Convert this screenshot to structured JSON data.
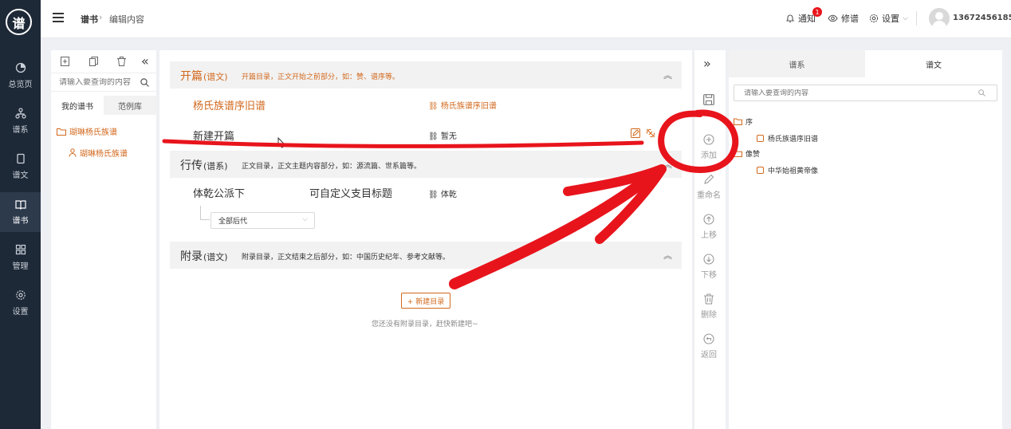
{
  "nav": {
    "logo": "谱",
    "items": [
      "总览页",
      "谱系",
      "谱文",
      "谱书",
      "管理",
      "设置"
    ]
  },
  "topbar": {
    "crumb_1": "谱书",
    "crumb_2": "编辑内容",
    "notify_label": "通知",
    "notify_badge": "1",
    "preview_label": "修谱",
    "settings_label": "设置",
    "phone": "13672456185"
  },
  "left": {
    "search_placeholder": "请输入要查询的内容",
    "tab_mine": "我的谱书",
    "tab_examples": "范例库",
    "tree_root": "瑚琳杨氏族谱",
    "tree_child": "瑚琳杨氏族谱"
  },
  "middle": {
    "s1_title": "开篇",
    "s1_tag": "(谱文)",
    "s1_desc": "开篇目录，正文开始之前部分，如：赞、谱序等。",
    "s1_row1_name": "杨氏族谱序旧谱",
    "s1_row1_link": "杨氏族谱序旧谱",
    "s1_row2_name": "新建开篇",
    "s1_row2_link": "暂无",
    "s2_title": "行传",
    "s2_tag": "(谱系)",
    "s2_desc": "正文目录，正文主题内容部分，如：源流篇、世系篇等。",
    "s2_row1_name": "体乾公派下",
    "s2_row1_custom": "可自定义支目标题",
    "s2_row1_link": "体乾",
    "s2_select": "全部后代",
    "s3_title": "附录",
    "s3_tag": "(谱文)",
    "s3_desc": "附录目录，正文结束之后部分，如：中国历史纪年、参考文献等。",
    "new_button": "+ 新建目录",
    "empty_hint": "您还没有附录目录，赶快新建吧~"
  },
  "toolbar": {
    "add": "添加",
    "rename": "重命名",
    "up": "上移",
    "down": "下移",
    "delete": "删除",
    "back": "返回"
  },
  "right": {
    "tab_lineage": "谱系",
    "tab_text": "谱文",
    "search_placeholder": "请输入要查询的内容",
    "folder1": "序",
    "folder1_item": "杨氏族谱序旧谱",
    "folder2": "像赞",
    "folder2_item": "中华始祖黄帝像"
  },
  "colors": {
    "accent": "#d2691e",
    "annotation": "#e8141c",
    "sidebar": "#1e2937"
  }
}
